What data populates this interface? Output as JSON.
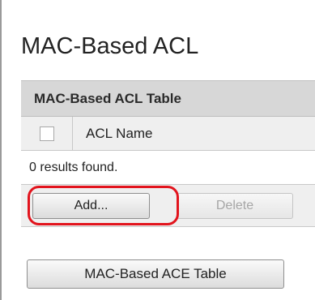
{
  "page": {
    "title": "MAC-Based ACL"
  },
  "acl_table": {
    "caption": "MAC-Based ACL Table",
    "columns": [
      "ACL Name"
    ],
    "rows": [],
    "results_text": "0 results found."
  },
  "actions": {
    "add_label": "Add...",
    "delete_label": "Delete"
  },
  "footer": {
    "ace_table_label": "MAC-Based ACE Table"
  },
  "annotation": {
    "highlight_color": "#e2141d",
    "highlighted_control": "add-button"
  },
  "colors": {
    "caption_bg": "#d7d7d7",
    "row_bg": "#efefef",
    "disabled_text": "#a6a6a6"
  }
}
